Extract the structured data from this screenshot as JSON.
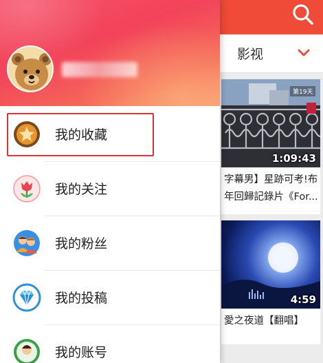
{
  "background": {
    "tab_label": "影视",
    "videos": [
      {
        "duration": "1:09:43",
        "corner_tag": "第19天",
        "title_line1": "字幕男】星跡可考!布",
        "title_line2": "年回歸記錄片《For..."
      },
      {
        "duration": "4:59",
        "title_line1": "愛之夜道【翻唱】"
      }
    ]
  },
  "drawer": {
    "menu": [
      {
        "label": "我的收藏",
        "icon": "star-icon",
        "highlighted": true
      },
      {
        "label": "我的关注",
        "icon": "tulip-icon"
      },
      {
        "label": "我的粉丝",
        "icon": "people-icon"
      },
      {
        "label": "我的投稿",
        "icon": "diamond-icon"
      },
      {
        "label": "我的账号",
        "icon": "user-icon"
      }
    ]
  },
  "colors": {
    "accent": "#ef4b38",
    "highlight_border": "#d73535",
    "favorites_icon": "#d9822b",
    "follows_icon": "#ea4f5c",
    "fans_icon": "#3a8fe0",
    "posts_icon": "#2f8fd6",
    "account_icon": "#3e9f4a"
  }
}
